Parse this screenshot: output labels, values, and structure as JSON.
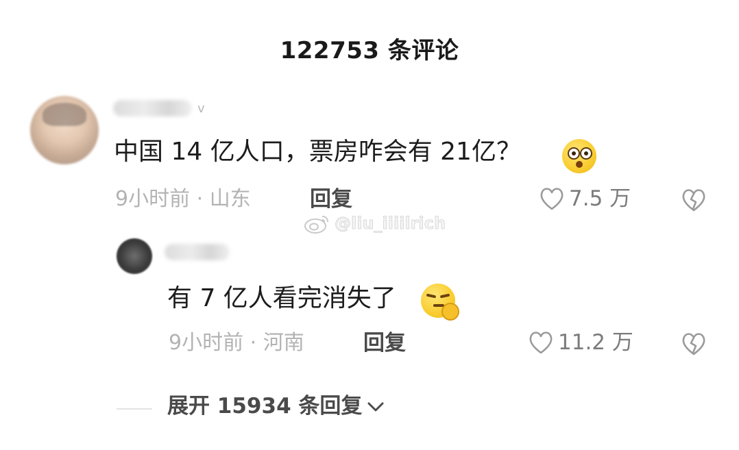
{
  "header": {
    "title": "122753 条评论"
  },
  "comment": {
    "username_suffix": "v",
    "text": "中国 14 亿人口，票房咋会有 21亿？",
    "emoji": "shocked-face-emoji",
    "time": "9小时前 · 山东",
    "reply_label": "回复",
    "likes": "7.5 万"
  },
  "reply": {
    "text": "有 7 亿人看完消失了",
    "emoji": "smirking-hand-emoji",
    "time": "9小时前 · 河南",
    "reply_label": "回复",
    "likes": "11.2 万"
  },
  "watermark": {
    "text": "@liu_iiiilrich"
  },
  "expand": {
    "label": "展开 15934 条回复"
  },
  "colors": {
    "meta_gray": "#b3b3b3",
    "primary_text": "#1c1c1c",
    "emoji_yellow": "#f9cd30"
  },
  "icons": {
    "like": "heart-outline-icon",
    "dislike": "broken-heart-icon",
    "expand": "chevron-down-icon",
    "watermark": "weibo-logo-icon"
  }
}
